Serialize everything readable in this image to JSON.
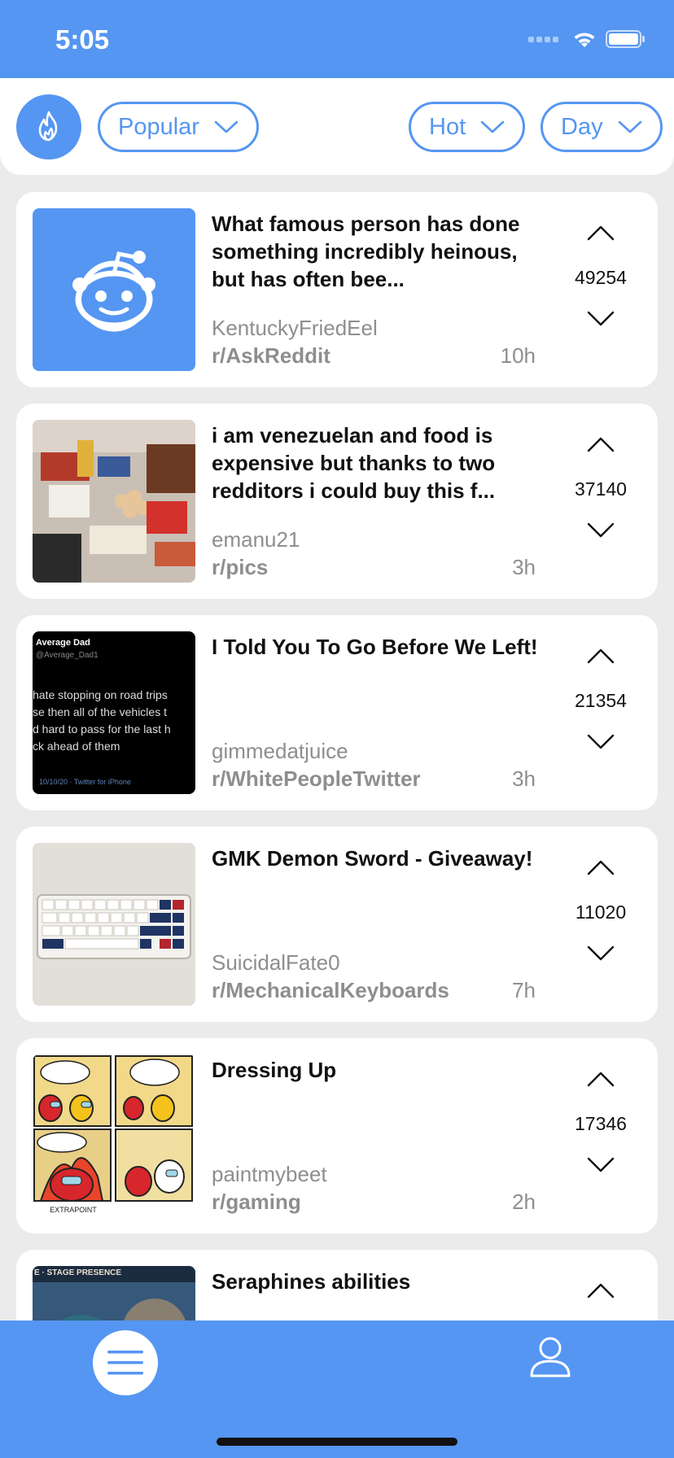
{
  "status_bar": {
    "time": "5:05"
  },
  "filters": {
    "feed": "Popular",
    "sort": "Hot",
    "range": "Day"
  },
  "posts": [
    {
      "title": "What famous person has done something incredibly heinous, but has often bee...",
      "author": "KentuckyFriedEel",
      "subreddit": "r/AskReddit",
      "age": "10h",
      "score": "49254",
      "thumb": "reddit-default"
    },
    {
      "title": "i am venezuelan and food is expensive but thanks to two redditors i could buy this f...",
      "author": "emanu21",
      "subreddit": "r/pics",
      "age": "3h",
      "score": "37140",
      "thumb": "groceries-photo"
    },
    {
      "title": "I Told You To Go Before We Left!",
      "author": "gimmedatjuice",
      "subreddit": "r/WhitePeopleTwitter",
      "age": "3h",
      "score": "21354",
      "thumb": "tweet-screenshot",
      "thumb_text": {
        "name": "Average Dad",
        "handle": "@Average_Dad1",
        "lines": [
          "hate stopping on road trips",
          "se then all of the vehicles t",
          "d hard to pass for the last h",
          "ck ahead of them"
        ],
        "footer": "10/10/20 · Twitter for iPhone"
      }
    },
    {
      "title": "GMK Demon Sword - Giveaway!",
      "author": "SuicidalFate0",
      "subreddit": "r/MechanicalKeyboards",
      "age": "7h",
      "score": "11020",
      "thumb": "keyboard-photo"
    },
    {
      "title": "Dressing Up",
      "author": "paintmybeet",
      "subreddit": "r/gaming",
      "age": "2h",
      "score": "17346",
      "thumb": "comic-panels"
    },
    {
      "title": "Seraphines abilities",
      "author": "",
      "subreddit": "",
      "age": "",
      "score": "",
      "thumb": "game-screenshot",
      "thumb_text": {
        "caption": "E · STAGE PRESENCE"
      }
    }
  ],
  "colors": {
    "accent": "#5596f2",
    "background": "#ebebeb",
    "card": "#ffffff",
    "meta_text": "#8e8e8e"
  },
  "icons": {
    "feed_icon": "flame-icon",
    "menu": "hamburger-icon",
    "profile": "user-icon",
    "upvote": "chevron-up-icon",
    "downvote": "chevron-down-icon"
  }
}
